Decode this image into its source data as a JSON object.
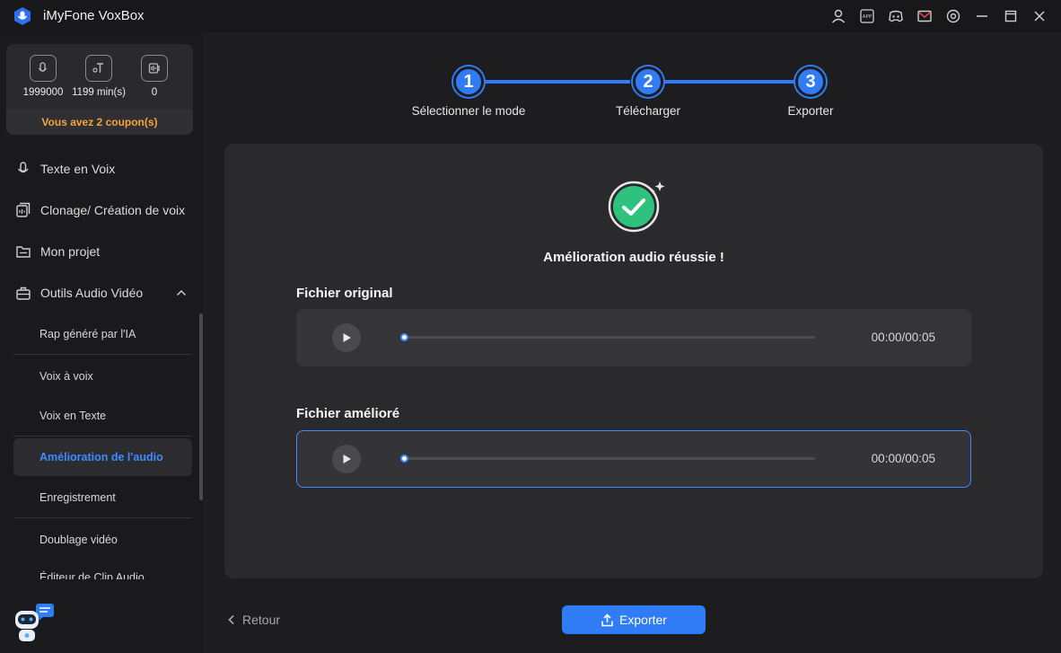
{
  "app": {
    "title": "iMyFone VoxBox"
  },
  "stats": [
    {
      "value": "1999000",
      "icon": "tts-icon"
    },
    {
      "value": "1199 min(s)",
      "icon": "stt-icon"
    },
    {
      "value": "0",
      "icon": "clone-icon"
    }
  ],
  "coupon": "Vous avez 2 coupon(s)",
  "nav": {
    "tts": "Texte en Voix",
    "clone": "Clonage/ Création de voix",
    "project": "Mon projet",
    "tools": "Outils Audio Vidéo"
  },
  "subnav": [
    "Rap généré par l'IA",
    "Voix à voix",
    "Voix en Texte",
    "Amélioration de l'audio",
    "Enregistrement",
    "Doublage vidéo",
    "Éditeur de Clip Audio"
  ],
  "steps": [
    {
      "num": "1",
      "label": "Sélectionner le mode"
    },
    {
      "num": "2",
      "label": "Télécharger"
    },
    {
      "num": "3",
      "label": "Exporter"
    }
  ],
  "result": {
    "message": "Amélioration audio réussie !"
  },
  "original": {
    "label": "Fichier original",
    "time": "00:00/00:05",
    "progress": 0
  },
  "improved": {
    "label": "Fichier amélioré",
    "time": "00:00/00:05",
    "progress": 0
  },
  "footer": {
    "back": "Retour",
    "export": "Exporter"
  },
  "colors": {
    "accent": "#2f7cf6",
    "coupon": "#f3a43a",
    "success": "#2ec27e"
  }
}
